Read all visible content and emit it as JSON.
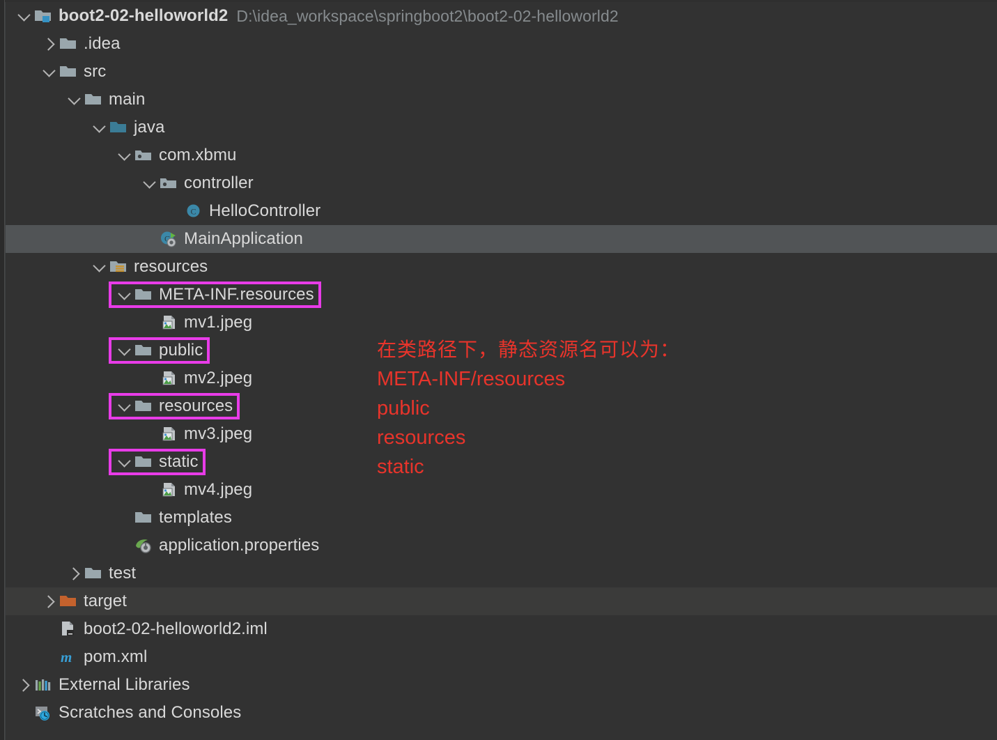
{
  "window": {
    "kind": "ide-project-tree",
    "background_color": "#323232",
    "selected_row_color": "#515456",
    "hover_row_color": "#3b3b3a",
    "text_color": "#d9d9d9",
    "path_text_color": "#868b8e",
    "highlight_box_color": "#e83ce8",
    "annotation_color": "#e8342b"
  },
  "project": {
    "root_label": "boot2-02-helloworld2",
    "root_path": "D:\\idea_workspace\\springboot2\\boot2-02-helloworld2"
  },
  "tree": {
    "rows": [
      {
        "id": "root",
        "label": "boot2-02-helloworld2",
        "path": "D:\\idea_workspace\\springboot2\\boot2-02-helloworld2",
        "icon": "module-folder-icon",
        "depth": 0,
        "chevron": "down",
        "state": "normal",
        "boxed": false
      },
      {
        "id": "idea",
        "label": ".idea",
        "path": "",
        "icon": "folder-icon",
        "depth": 1,
        "chevron": "right",
        "state": "normal",
        "boxed": false
      },
      {
        "id": "src",
        "label": "src",
        "path": "",
        "icon": "folder-icon",
        "depth": 1,
        "chevron": "down",
        "state": "normal",
        "boxed": false
      },
      {
        "id": "main",
        "label": "main",
        "path": "",
        "icon": "folder-icon",
        "depth": 2,
        "chevron": "down",
        "state": "normal",
        "boxed": false
      },
      {
        "id": "java",
        "label": "java",
        "path": "",
        "icon": "source-root-folder-icon",
        "depth": 3,
        "chevron": "down",
        "state": "normal",
        "boxed": false
      },
      {
        "id": "com-xbmu",
        "label": "com.xbmu",
        "path": "",
        "icon": "package-icon",
        "depth": 4,
        "chevron": "down",
        "state": "normal",
        "boxed": false
      },
      {
        "id": "controller",
        "label": "controller",
        "path": "",
        "icon": "package-icon",
        "depth": 5,
        "chevron": "down",
        "state": "normal",
        "boxed": false
      },
      {
        "id": "hellocontroller",
        "label": "HelloController",
        "path": "",
        "icon": "java-class-icon",
        "depth": 6,
        "chevron": "blank",
        "state": "normal",
        "boxed": false
      },
      {
        "id": "mainapplication",
        "label": "MainApplication",
        "path": "",
        "icon": "spring-boot-class-icon",
        "depth": 5,
        "chevron": "blank",
        "state": "selected",
        "boxed": false
      },
      {
        "id": "resources",
        "label": "resources",
        "path": "",
        "icon": "resource-root-icon",
        "depth": 3,
        "chevron": "down",
        "state": "normal",
        "boxed": false
      },
      {
        "id": "meta-inf",
        "label": "META-INF.resources",
        "path": "",
        "icon": "folder-icon",
        "depth": 4,
        "chevron": "down",
        "state": "normal",
        "boxed": true
      },
      {
        "id": "mv1",
        "label": "mv1.jpeg",
        "path": "",
        "icon": "image-file-icon",
        "depth": 5,
        "chevron": "blank",
        "state": "normal",
        "boxed": false
      },
      {
        "id": "public",
        "label": "public",
        "path": "",
        "icon": "folder-icon",
        "depth": 4,
        "chevron": "down",
        "state": "normal",
        "boxed": true
      },
      {
        "id": "mv2",
        "label": "mv2.jpeg",
        "path": "",
        "icon": "image-file-icon",
        "depth": 5,
        "chevron": "blank",
        "state": "normal",
        "boxed": false
      },
      {
        "id": "resources-dir",
        "label": "resources",
        "path": "",
        "icon": "folder-icon",
        "depth": 4,
        "chevron": "down",
        "state": "normal",
        "boxed": true
      },
      {
        "id": "mv3",
        "label": "mv3.jpeg",
        "path": "",
        "icon": "image-file-icon",
        "depth": 5,
        "chevron": "blank",
        "state": "normal",
        "boxed": false
      },
      {
        "id": "static",
        "label": "static",
        "path": "",
        "icon": "folder-icon",
        "depth": 4,
        "chevron": "down",
        "state": "normal",
        "boxed": true
      },
      {
        "id": "mv4",
        "label": "mv4.jpeg",
        "path": "",
        "icon": "image-file-icon",
        "depth": 5,
        "chevron": "blank",
        "state": "normal",
        "boxed": false
      },
      {
        "id": "templates",
        "label": "templates",
        "path": "",
        "icon": "folder-icon",
        "depth": 4,
        "chevron": "blank",
        "state": "normal",
        "boxed": false
      },
      {
        "id": "appprops",
        "label": "application.properties",
        "path": "",
        "icon": "spring-properties-icon",
        "depth": 4,
        "chevron": "blank",
        "state": "normal",
        "boxed": false
      },
      {
        "id": "test",
        "label": "test",
        "path": "",
        "icon": "folder-icon",
        "depth": 2,
        "chevron": "right",
        "state": "normal",
        "boxed": false
      },
      {
        "id": "target",
        "label": "target",
        "path": "",
        "icon": "excluded-folder-icon",
        "depth": 1,
        "chevron": "right",
        "state": "hovered",
        "boxed": false
      },
      {
        "id": "iml",
        "label": "boot2-02-helloworld2.iml",
        "path": "",
        "icon": "iml-file-icon",
        "depth": 1,
        "chevron": "blank",
        "state": "normal",
        "boxed": false
      },
      {
        "id": "pom",
        "label": "pom.xml",
        "path": "",
        "icon": "maven-pom-icon",
        "depth": 1,
        "chevron": "blank",
        "state": "normal",
        "boxed": false
      },
      {
        "id": "external-libs",
        "label": "External Libraries",
        "path": "",
        "icon": "libraries-icon",
        "depth": 0,
        "chevron": "right",
        "state": "normal",
        "boxed": false
      },
      {
        "id": "scratches",
        "label": "Scratches and Consoles",
        "path": "",
        "icon": "scratches-icon",
        "depth": 0,
        "chevron": "blank",
        "state": "normal",
        "boxed": false
      }
    ]
  },
  "annotation": {
    "title": "在类路径下，静态资源名可以为：",
    "lines": [
      "META-INF/resources",
      "public",
      "resources",
      "static"
    ]
  }
}
